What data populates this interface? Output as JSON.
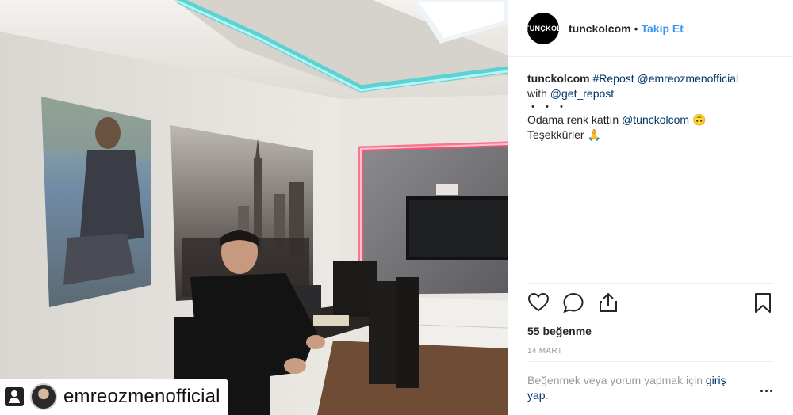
{
  "photo": {
    "repost_username": "emreozmenofficial"
  },
  "header": {
    "logo_text": "TUNÇKOL",
    "username": "tunckolcom",
    "separator": "•",
    "follow_label": "Takip Et"
  },
  "caption": {
    "username": "tunckolcom",
    "hashtag": "#Repost",
    "mention_1": "@emreozmenofficial",
    "with_word": "with",
    "mention_2": "@get_repost",
    "dots": "・・・",
    "line_text": "Odama renk kattın",
    "mention_3": "@tunckolcom",
    "emoji_1": "🙃",
    "thanks": "Teşekkürler",
    "emoji_2": "🙏"
  },
  "actions": {
    "icons": [
      "heart-icon",
      "comment-icon",
      "share-icon",
      "bookmark-icon"
    ],
    "likes": "55 beğenme",
    "date": "14 MART"
  },
  "footer": {
    "login_prefix": "Beğenmek veya yorum yapmak için",
    "login_link": "giriş yap",
    "login_suffix": ".",
    "more": "..."
  },
  "colors": {
    "accent": "#3897f0",
    "link": "#003569",
    "muted": "#999999",
    "led_teal": "#3fd0d4",
    "led_red": "#ff4d6d"
  }
}
